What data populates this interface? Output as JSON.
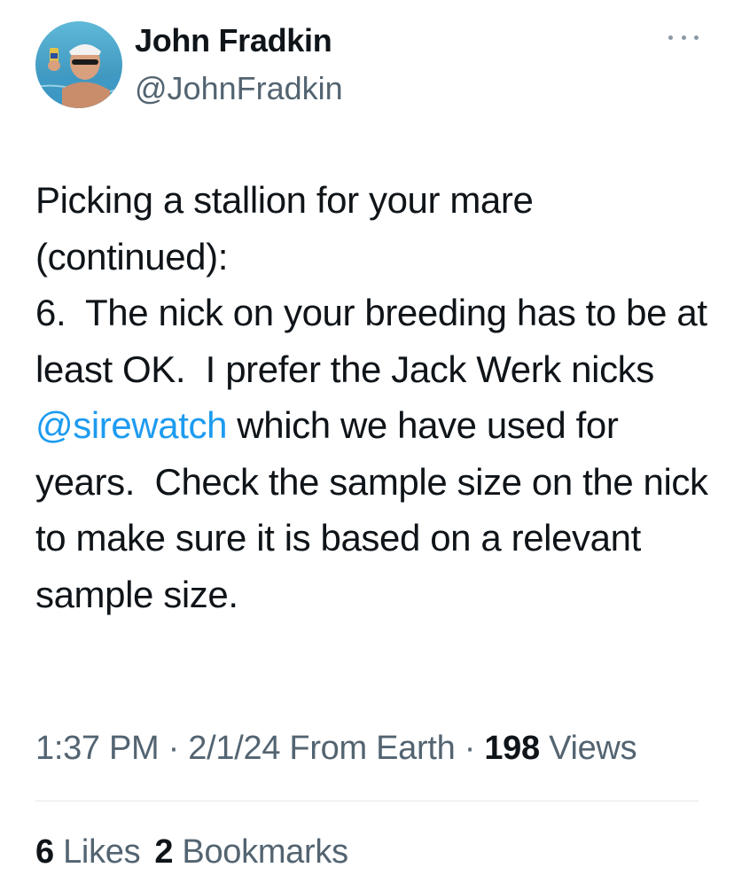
{
  "author": {
    "display_name": "John Fradkin",
    "handle": "@JohnFradkin",
    "avatar_icon": "profile-photo"
  },
  "menu_icon": "more-options-icon",
  "tweet": {
    "text_before_mention": "Picking a stallion for your mare\n(continued):\n6.  The nick on your breeding has to be at least OK.  I prefer the Jack Werk nicks ",
    "mention": "@sirewatch",
    "text_after_mention": " which we have used for years.  Check the sample size on the nick to make sure it is based on a relevant sample size."
  },
  "meta": {
    "time": "1:37 PM",
    "sep1": " · ",
    "date": "2/1/24",
    "source": " From Earth",
    "sep2": " · ",
    "views_count": "198",
    "views_label": " Views"
  },
  "stats": {
    "likes_count": "6",
    "likes_label": " Likes",
    "bookmarks_count": "2",
    "bookmarks_label": " Bookmarks"
  },
  "colors": {
    "text": "#0f1419",
    "secondary": "#536471",
    "link": "#1d9bf0",
    "divider": "#e1e6ea"
  }
}
